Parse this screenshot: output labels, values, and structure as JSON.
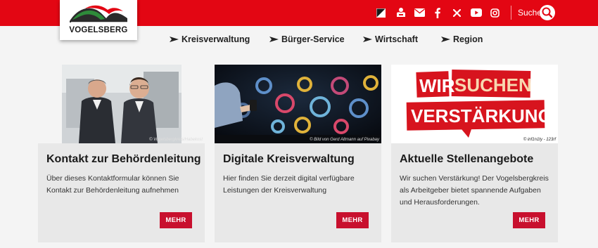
{
  "header": {
    "logo_text": "VOGELSBERG",
    "social_icons": [
      "contrast-icon",
      "sign-language-icon",
      "mail-icon",
      "facebook-icon",
      "x-icon",
      "youtube-icon",
      "instagram-icon"
    ],
    "search_label": "Suche",
    "brand_color": "#e30613"
  },
  "nav": {
    "items": [
      {
        "label": "Kreisverwaltung"
      },
      {
        "label": "Bürger-Service"
      },
      {
        "label": "Wirtschaft"
      },
      {
        "label": "Region"
      }
    ]
  },
  "cards": [
    {
      "image_credit": "© Vogelsbergkreis/Habekost",
      "title": "Kontakt zur Behördenleitung",
      "text": "Über dieses Kontaktformular können Sie Kontakt zur Behördenleitung aufnehmen",
      "button": "MEHR"
    },
    {
      "image_credit": "© Bild von Gerd Altmann auf Pixabay",
      "title": "Digitale Kreisverwaltung",
      "text": "Hier finden Sie derzeit digital verfügbare Leistungen der Kreisverwaltung",
      "button": "MEHR"
    },
    {
      "image_credit": "© inf1n1ty - 123rf",
      "image_text_line1_a": "WIR",
      "image_text_line1_b": "SUCHEN",
      "image_text_line2": "VERSTÄRKUNG",
      "title": "Aktuelle Stellenangebote",
      "text": "Wir suchen Verstärkung! Der Vogelsbergkreis als Arbeitgeber bietet spannende Aufgaben und Herausforderungen.",
      "button": "MEHR"
    }
  ]
}
